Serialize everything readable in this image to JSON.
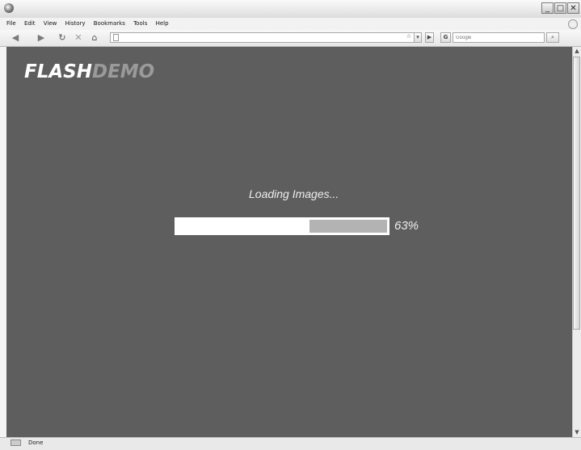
{
  "window": {
    "minimize": "_",
    "maximize": "□",
    "close": "✕"
  },
  "menu": [
    "File",
    "Edit",
    "View",
    "History",
    "Bookmarks",
    "Tools",
    "Help"
  ],
  "toolbar": {
    "back": "◀",
    "forward": "▶",
    "reload": "↻",
    "stop": "✕",
    "home": "⌂",
    "url_value": "",
    "bookmark_btn": "☆",
    "dropdown_btn": "▾",
    "go_btn": "▶",
    "search_engine": "G",
    "search_placeholder": "Google",
    "search_btn": "⌕"
  },
  "page": {
    "logo_part1": "FLASH",
    "logo_part2": "DEMO",
    "loading_text": "Loading Images...",
    "progress_percent": 63,
    "progress_label": "63%"
  },
  "status": {
    "text": "Done"
  },
  "colors": {
    "content_bg": "#5e5e5e",
    "progress_fill": "#ffffff",
    "progress_remaining": "#b3b3b3"
  }
}
